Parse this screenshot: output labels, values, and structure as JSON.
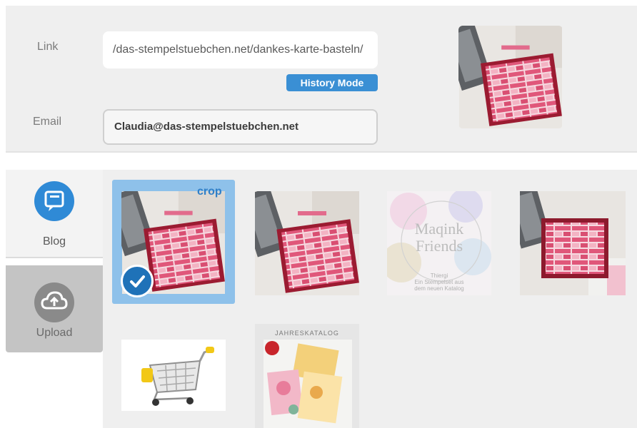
{
  "form": {
    "link_label": "Link",
    "link_value": "/das-stempelstuebchen.net/dankes-karte-basteln/",
    "history_mode_label": "History Mode",
    "email_label": "Email",
    "email_value": "Claudia@das-stempelstuebchen.net"
  },
  "tabs": [
    {
      "label": "Blog",
      "icon": "comment-icon",
      "active": true
    },
    {
      "label": "Upload",
      "icon": "cloud-upload-icon",
      "active": false
    }
  ],
  "grid": {
    "crop_label": "crop",
    "selected_index": 0,
    "images": [
      {
        "name": "pink-card-photo-1"
      },
      {
        "name": "pink-card-photo-2"
      },
      {
        "name": "maqink-friends-graphic",
        "text": [
          "Maqink",
          "Friends",
          "Thiergi",
          "Ein Stempelset aus",
          "dem neuen Katalog"
        ]
      },
      {
        "name": "pink-card-photo-3"
      },
      {
        "name": "shopping-cart-photo"
      },
      {
        "name": "jahreskatalog-cover",
        "text": [
          "JAHRESKATALOG"
        ]
      }
    ]
  },
  "colors": {
    "accent": "#2f8ad6",
    "history_button": "#3a8fd4",
    "selected_frame": "#8ec1ea",
    "check_badge": "#1f72b8",
    "panel_bg": "#efefef",
    "card_pink": "#e0577a"
  }
}
